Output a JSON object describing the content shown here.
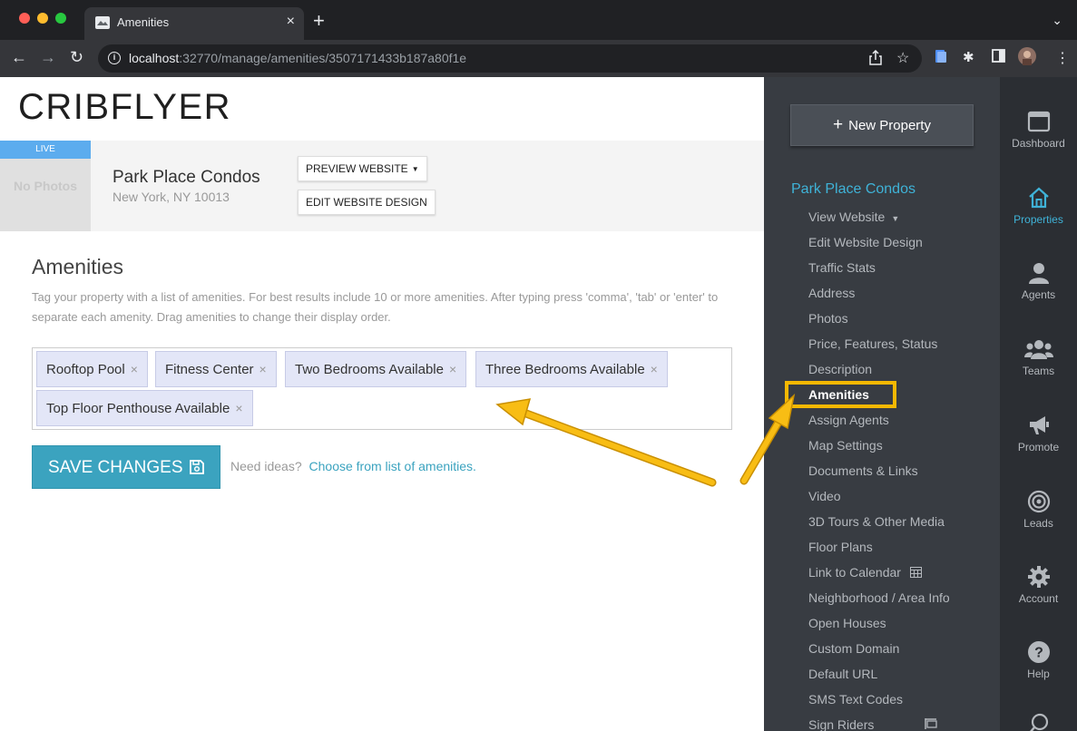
{
  "browser": {
    "tab_title": "Amenities",
    "tab_close": "×",
    "new_tab": "+",
    "url_host": "localhost",
    "url_path": ":32770/manage/amenities/3507171433b187a80f1e"
  },
  "header": {
    "logo": "CRIBFLYER"
  },
  "property": {
    "live_badge": "LIVE",
    "photo_placeholder": "No Photos",
    "name": "Park Place Condos",
    "address": "New York, NY 10013",
    "preview_button": "PREVIEW WEBSITE",
    "edit_button": "EDIT WEBSITE DESIGN"
  },
  "amenities": {
    "title": "Amenities",
    "description": "Tag your property with a list of amenities. For best results include 10 or more amenities. After typing press 'comma', 'tab' or 'enter' to separate each amenity. Drag amenities to change their display order.",
    "tags": [
      "Rooftop Pool",
      "Fitness Center",
      "Two Bedrooms Available",
      "Three Bedrooms Available",
      "Top Floor Penthouse Available"
    ],
    "remove_symbol": "×",
    "save_button": "SAVE CHANGES",
    "ideas_prompt": "Need ideas?",
    "ideas_link": "Choose from list of amenities."
  },
  "sidebar": {
    "new_property": "New Property",
    "property_heading": "Park Place Condos",
    "items": [
      "View Website",
      "Edit Website Design",
      "Traffic Stats",
      "Address",
      "Photos",
      "Price, Features, Status",
      "Description",
      "Amenities",
      "Assign Agents",
      "Map Settings",
      "Documents & Links",
      "Video",
      "3D Tours & Other Media",
      "Floor Plans",
      "Link to Calendar",
      "Neighborhood / Area Info",
      "Open Houses",
      "Custom Domain",
      "Default URL",
      "SMS Text Codes",
      "Sign Riders"
    ],
    "active_item": "Amenities"
  },
  "rail": {
    "items": [
      "Dashboard",
      "Properties",
      "Agents",
      "Teams",
      "Promote",
      "Leads",
      "Account",
      "Help"
    ],
    "active_item": "Properties"
  },
  "colors": {
    "accent": "#3ba3bf",
    "highlight": "#f5b800",
    "sidebar_bg": "#383c42",
    "rail_bg": "#2b2e33",
    "tag_bg": "#e3e6f7"
  }
}
